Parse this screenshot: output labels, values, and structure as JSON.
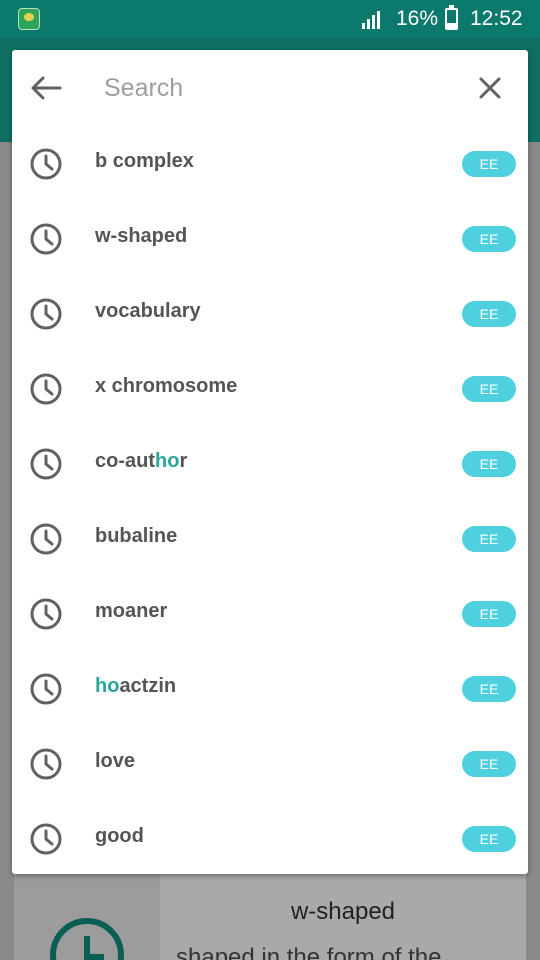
{
  "status_bar": {
    "battery_percent": "16%",
    "time": "12:52",
    "icons": [
      "app-notification-icon",
      "signal-icon",
      "battery-charging-icon"
    ]
  },
  "search": {
    "placeholder": "Search",
    "value": "",
    "back_icon": "arrow-left-icon",
    "clear_icon": "close-icon"
  },
  "history": {
    "icon": "history-clock-icon",
    "highlight_color": "#2aa59b",
    "badge_color": "#4fd0df",
    "items": [
      {
        "before": "b complex",
        "match": "",
        "after": "",
        "lang": "EE"
      },
      {
        "before": "w-shaped",
        "match": "",
        "after": "",
        "lang": "EE"
      },
      {
        "before": "vocabulary",
        "match": "",
        "after": "",
        "lang": "EE"
      },
      {
        "before": "x chromosome",
        "match": "",
        "after": "",
        "lang": "EE"
      },
      {
        "before": "co-aut",
        "match": "ho",
        "after": "r",
        "lang": "EE"
      },
      {
        "before": "bubaline",
        "match": "",
        "after": "",
        "lang": "EE"
      },
      {
        "before": "moaner",
        "match": "",
        "after": "",
        "lang": "EE"
      },
      {
        "before": "",
        "match": "ho",
        "after": "actzin",
        "lang": "EE"
      },
      {
        "before": "love",
        "match": "",
        "after": "",
        "lang": "EE"
      },
      {
        "before": "good",
        "match": "",
        "after": "",
        "lang": "EE"
      }
    ]
  },
  "background": {
    "result_title": "w-shaped",
    "result_definition": "shaped in the form of the"
  },
  "colors": {
    "status_bar": "#0b7a6c",
    "app_bar": "#0f6f63",
    "accent": "#2aa59b"
  }
}
